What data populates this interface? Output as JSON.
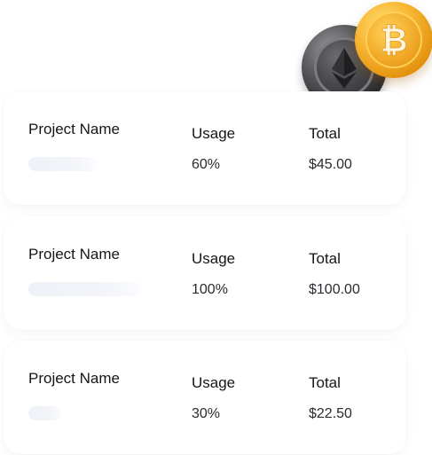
{
  "coins": {
    "eth_icon": "ethereum-coin-icon",
    "btc_icon": "bitcoin-coin-icon",
    "btc_symbol": "₿"
  },
  "columns": {
    "project": "Project Name",
    "usage": "Usage",
    "total": "Total"
  },
  "projects": [
    {
      "name": "Project Name",
      "usage_label": "Usage",
      "total_label": "Total",
      "usage": "60%",
      "usage_fraction": 0.6,
      "total": "$45.00"
    },
    {
      "name": "Project Name",
      "usage_label": "Usage",
      "total_label": "Total",
      "usage": "100%",
      "usage_fraction": 1.0,
      "total": "$100.00"
    },
    {
      "name": "Project Name",
      "usage_label": "Usage",
      "total_label": "Total",
      "usage": "30%",
      "usage_fraction": 0.3,
      "total": "$22.50"
    }
  ],
  "colors": {
    "text": "#15151a",
    "bar": "#eef1f7",
    "btc": "#f7b733",
    "eth": "#4a4a4f"
  }
}
